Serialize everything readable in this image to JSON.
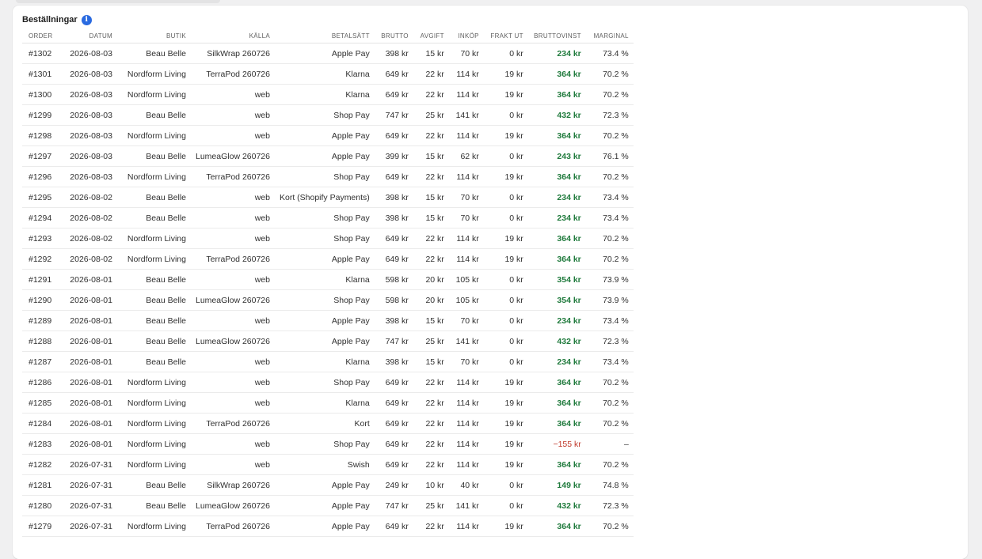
{
  "section": {
    "title": "Beställningar",
    "info_icon": "info-icon"
  },
  "colors": {
    "positive": "#1f7a3c",
    "negative": "#c0392b",
    "accent": "#2a6ae0"
  },
  "table": {
    "headers": [
      "ORDER",
      "DATUM",
      "BUTIK",
      "KÄLLA",
      "BETALSÄTT",
      "BRUTTO",
      "AVGIFT",
      "INKÖP",
      "FRAKT UT",
      "BRUTTOVINST",
      "MARGINAL"
    ],
    "rows": [
      {
        "order": "#1302",
        "datum": "2026-08-03",
        "butik": "Beau Belle",
        "kalla": "SilkWrap 260726",
        "betalsatt": "Apple Pay",
        "brutto": "398 kr",
        "avgift": "15 kr",
        "inkop": "70 kr",
        "frakt": "0 kr",
        "bruttovinst": "234 kr",
        "marginal": "73.4 %",
        "negative": false
      },
      {
        "order": "#1301",
        "datum": "2026-08-03",
        "butik": "Nordform Living",
        "kalla": "TerraPod 260726",
        "betalsatt": "Klarna",
        "brutto": "649 kr",
        "avgift": "22 kr",
        "inkop": "114 kr",
        "frakt": "19 kr",
        "bruttovinst": "364 kr",
        "marginal": "70.2 %",
        "negative": false
      },
      {
        "order": "#1300",
        "datum": "2026-08-03",
        "butik": "Nordform Living",
        "kalla": "web",
        "betalsatt": "Klarna",
        "brutto": "649 kr",
        "avgift": "22 kr",
        "inkop": "114 kr",
        "frakt": "19 kr",
        "bruttovinst": "364 kr",
        "marginal": "70.2 %",
        "negative": false
      },
      {
        "order": "#1299",
        "datum": "2026-08-03",
        "butik": "Beau Belle",
        "kalla": "web",
        "betalsatt": "Shop Pay",
        "brutto": "747 kr",
        "avgift": "25 kr",
        "inkop": "141 kr",
        "frakt": "0 kr",
        "bruttovinst": "432 kr",
        "marginal": "72.3 %",
        "negative": false
      },
      {
        "order": "#1298",
        "datum": "2026-08-03",
        "butik": "Nordform Living",
        "kalla": "web",
        "betalsatt": "Apple Pay",
        "brutto": "649 kr",
        "avgift": "22 kr",
        "inkop": "114 kr",
        "frakt": "19 kr",
        "bruttovinst": "364 kr",
        "marginal": "70.2 %",
        "negative": false
      },
      {
        "order": "#1297",
        "datum": "2026-08-03",
        "butik": "Beau Belle",
        "kalla": "LumeaGlow 260726",
        "betalsatt": "Apple Pay",
        "brutto": "399 kr",
        "avgift": "15 kr",
        "inkop": "62 kr",
        "frakt": "0 kr",
        "bruttovinst": "243 kr",
        "marginal": "76.1 %",
        "negative": false
      },
      {
        "order": "#1296",
        "datum": "2026-08-03",
        "butik": "Nordform Living",
        "kalla": "TerraPod 260726",
        "betalsatt": "Shop Pay",
        "brutto": "649 kr",
        "avgift": "22 kr",
        "inkop": "114 kr",
        "frakt": "19 kr",
        "bruttovinst": "364 kr",
        "marginal": "70.2 %",
        "negative": false
      },
      {
        "order": "#1295",
        "datum": "2026-08-02",
        "butik": "Beau Belle",
        "kalla": "web",
        "betalsatt": "Kort (Shopify Payments)",
        "brutto": "398 kr",
        "avgift": "15 kr",
        "inkop": "70 kr",
        "frakt": "0 kr",
        "bruttovinst": "234 kr",
        "marginal": "73.4 %",
        "negative": false
      },
      {
        "order": "#1294",
        "datum": "2026-08-02",
        "butik": "Beau Belle",
        "kalla": "web",
        "betalsatt": "Shop Pay",
        "brutto": "398 kr",
        "avgift": "15 kr",
        "inkop": "70 kr",
        "frakt": "0 kr",
        "bruttovinst": "234 kr",
        "marginal": "73.4 %",
        "negative": false
      },
      {
        "order": "#1293",
        "datum": "2026-08-02",
        "butik": "Nordform Living",
        "kalla": "web",
        "betalsatt": "Shop Pay",
        "brutto": "649 kr",
        "avgift": "22 kr",
        "inkop": "114 kr",
        "frakt": "19 kr",
        "bruttovinst": "364 kr",
        "marginal": "70.2 %",
        "negative": false
      },
      {
        "order": "#1292",
        "datum": "2026-08-02",
        "butik": "Nordform Living",
        "kalla": "TerraPod 260726",
        "betalsatt": "Apple Pay",
        "brutto": "649 kr",
        "avgift": "22 kr",
        "inkop": "114 kr",
        "frakt": "19 kr",
        "bruttovinst": "364 kr",
        "marginal": "70.2 %",
        "negative": false
      },
      {
        "order": "#1291",
        "datum": "2026-08-01",
        "butik": "Beau Belle",
        "kalla": "web",
        "betalsatt": "Klarna",
        "brutto": "598 kr",
        "avgift": "20 kr",
        "inkop": "105 kr",
        "frakt": "0 kr",
        "bruttovinst": "354 kr",
        "marginal": "73.9 %",
        "negative": false
      },
      {
        "order": "#1290",
        "datum": "2026-08-01",
        "butik": "Beau Belle",
        "kalla": "LumeaGlow 260726",
        "betalsatt": "Shop Pay",
        "brutto": "598 kr",
        "avgift": "20 kr",
        "inkop": "105 kr",
        "frakt": "0 kr",
        "bruttovinst": "354 kr",
        "marginal": "73.9 %",
        "negative": false
      },
      {
        "order": "#1289",
        "datum": "2026-08-01",
        "butik": "Beau Belle",
        "kalla": "web",
        "betalsatt": "Apple Pay",
        "brutto": "398 kr",
        "avgift": "15 kr",
        "inkop": "70 kr",
        "frakt": "0 kr",
        "bruttovinst": "234 kr",
        "marginal": "73.4 %",
        "negative": false
      },
      {
        "order": "#1288",
        "datum": "2026-08-01",
        "butik": "Beau Belle",
        "kalla": "LumeaGlow 260726",
        "betalsatt": "Apple Pay",
        "brutto": "747 kr",
        "avgift": "25 kr",
        "inkop": "141 kr",
        "frakt": "0 kr",
        "bruttovinst": "432 kr",
        "marginal": "72.3 %",
        "negative": false
      },
      {
        "order": "#1287",
        "datum": "2026-08-01",
        "butik": "Beau Belle",
        "kalla": "web",
        "betalsatt": "Klarna",
        "brutto": "398 kr",
        "avgift": "15 kr",
        "inkop": "70 kr",
        "frakt": "0 kr",
        "bruttovinst": "234 kr",
        "marginal": "73.4 %",
        "negative": false
      },
      {
        "order": "#1286",
        "datum": "2026-08-01",
        "butik": "Nordform Living",
        "kalla": "web",
        "betalsatt": "Shop Pay",
        "brutto": "649 kr",
        "avgift": "22 kr",
        "inkop": "114 kr",
        "frakt": "19 kr",
        "bruttovinst": "364 kr",
        "marginal": "70.2 %",
        "negative": false
      },
      {
        "order": "#1285",
        "datum": "2026-08-01",
        "butik": "Nordform Living",
        "kalla": "web",
        "betalsatt": "Klarna",
        "brutto": "649 kr",
        "avgift": "22 kr",
        "inkop": "114 kr",
        "frakt": "19 kr",
        "bruttovinst": "364 kr",
        "marginal": "70.2 %",
        "negative": false
      },
      {
        "order": "#1284",
        "datum": "2026-08-01",
        "butik": "Nordform Living",
        "kalla": "TerraPod 260726",
        "betalsatt": "Kort",
        "brutto": "649 kr",
        "avgift": "22 kr",
        "inkop": "114 kr",
        "frakt": "19 kr",
        "bruttovinst": "364 kr",
        "marginal": "70.2 %",
        "negative": false
      },
      {
        "order": "#1283",
        "datum": "2026-08-01",
        "butik": "Nordform Living",
        "kalla": "web",
        "betalsatt": "Shop Pay",
        "brutto": "649 kr",
        "avgift": "22 kr",
        "inkop": "114 kr",
        "frakt": "19 kr",
        "bruttovinst": "−155 kr",
        "marginal": "–",
        "negative": true
      },
      {
        "order": "#1282",
        "datum": "2026-07-31",
        "butik": "Nordform Living",
        "kalla": "web",
        "betalsatt": "Swish",
        "brutto": "649 kr",
        "avgift": "22 kr",
        "inkop": "114 kr",
        "frakt": "19 kr",
        "bruttovinst": "364 kr",
        "marginal": "70.2 %",
        "negative": false
      },
      {
        "order": "#1281",
        "datum": "2026-07-31",
        "butik": "Beau Belle",
        "kalla": "SilkWrap 260726",
        "betalsatt": "Apple Pay",
        "brutto": "249 kr",
        "avgift": "10 kr",
        "inkop": "40 kr",
        "frakt": "0 kr",
        "bruttovinst": "149 kr",
        "marginal": "74.8 %",
        "negative": false
      },
      {
        "order": "#1280",
        "datum": "2026-07-31",
        "butik": "Beau Belle",
        "kalla": "LumeaGlow 260726",
        "betalsatt": "Apple Pay",
        "brutto": "747 kr",
        "avgift": "25 kr",
        "inkop": "141 kr",
        "frakt": "0 kr",
        "bruttovinst": "432 kr",
        "marginal": "72.3 %",
        "negative": false
      },
      {
        "order": "#1279",
        "datum": "2026-07-31",
        "butik": "Nordform Living",
        "kalla": "TerraPod 260726",
        "betalsatt": "Apple Pay",
        "brutto": "649 kr",
        "avgift": "22 kr",
        "inkop": "114 kr",
        "frakt": "19 kr",
        "bruttovinst": "364 kr",
        "marginal": "70.2 %",
        "negative": false
      }
    ]
  }
}
